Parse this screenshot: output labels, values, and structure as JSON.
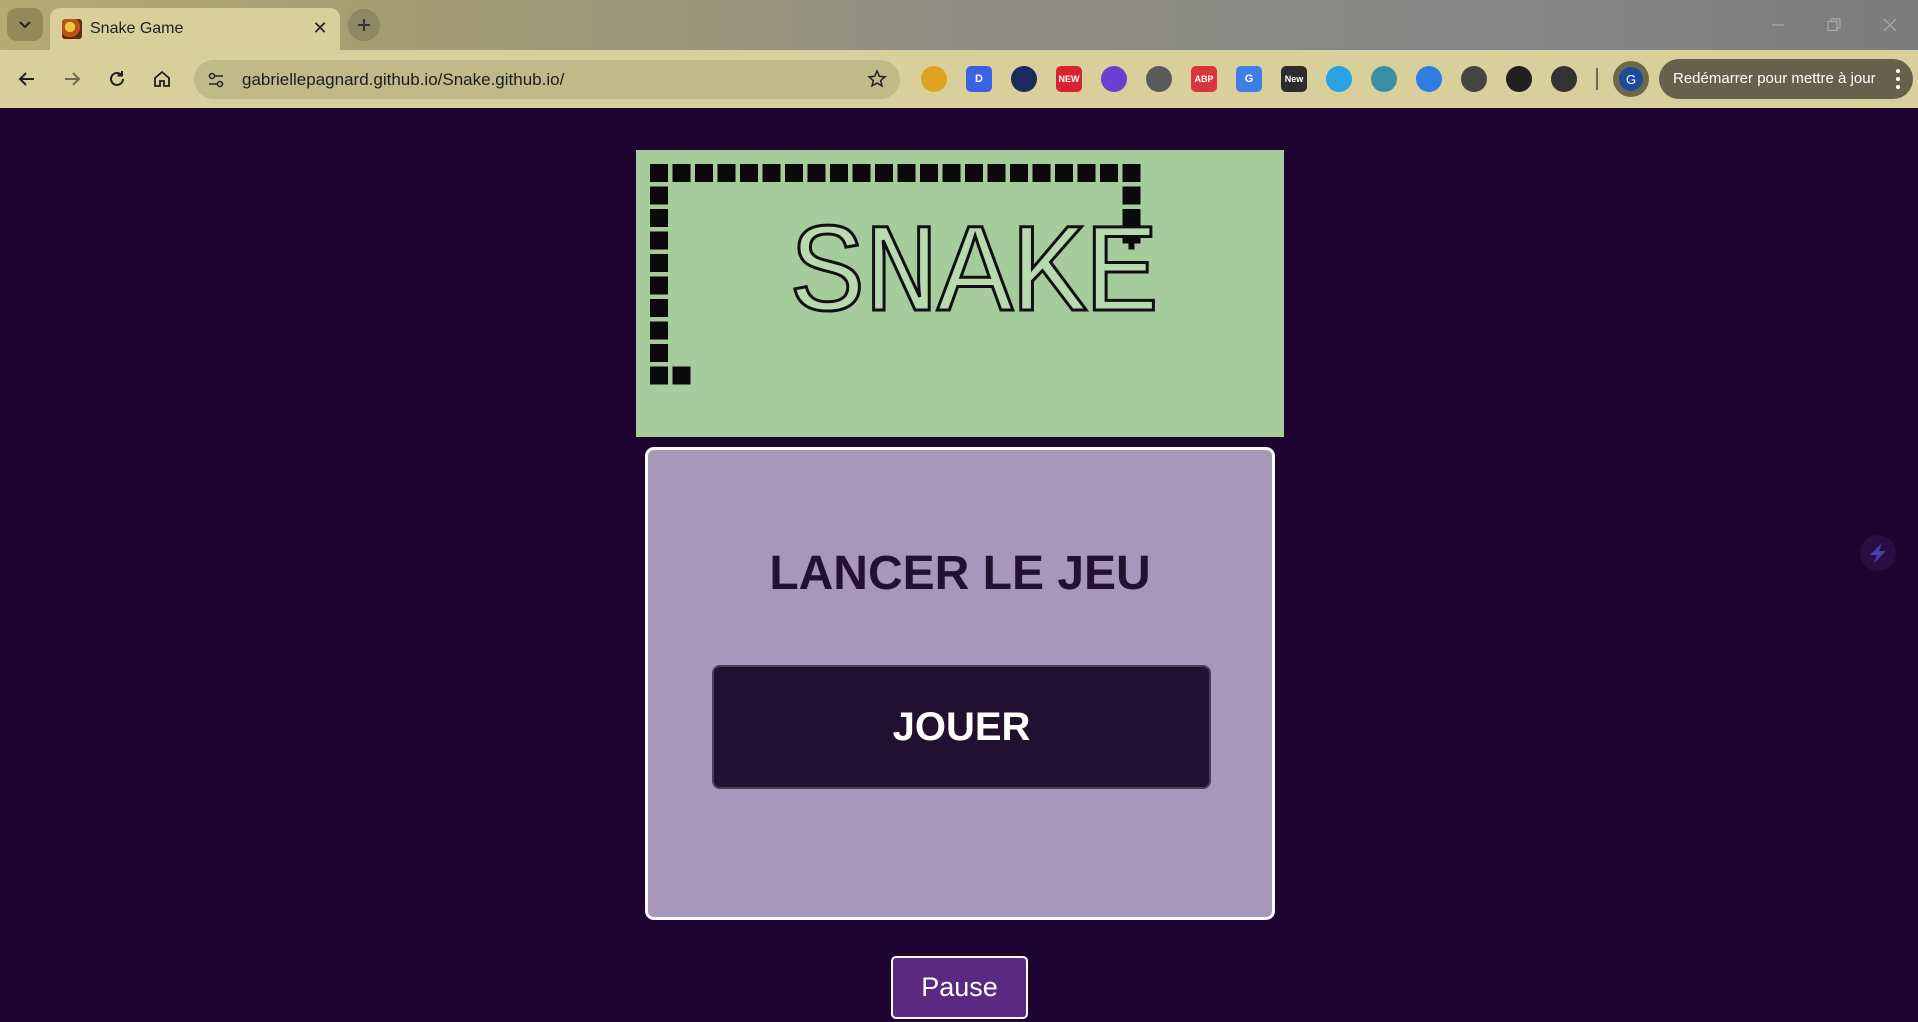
{
  "browser": {
    "tab": {
      "title": "Snake Game",
      "close_glyph": "✕"
    },
    "new_tab_glyph": "+",
    "address": {
      "url": "gabriellepagnard.github.io/Snake.github.io/"
    },
    "extensions": [
      {
        "name": "emoji-extension-icon",
        "label": "",
        "color": "#e0a31f"
      },
      {
        "name": "d-extension-icon",
        "label": "D",
        "color": "#3a62e3"
      },
      {
        "name": "flame-extension-icon",
        "label": "",
        "color": "#1b2a5c"
      },
      {
        "name": "new-badge-extension-icon",
        "label": "NEW",
        "color": "#d8232e"
      },
      {
        "name": "sparkle-extension-icon",
        "label": "",
        "color": "#6b3fd4"
      },
      {
        "name": "aperture-extension-icon",
        "label": "",
        "color": "#5a5a5a"
      },
      {
        "name": "adblock-extension-icon",
        "label": "ABP",
        "color": "#d7353a"
      },
      {
        "name": "translate-extension-icon",
        "label": "G",
        "color": "#3f7ee8"
      },
      {
        "name": "new-extension-icon",
        "label": "New",
        "color": "#2c2c2c"
      },
      {
        "name": "target-extension-icon",
        "label": "",
        "color": "#2aa1e0"
      },
      {
        "name": "react-extension-icon",
        "label": "",
        "color": "#3a8fa6"
      },
      {
        "name": "swirl-extension-icon",
        "label": "",
        "color": "#2e7ee0"
      },
      {
        "name": "eyedropper-extension-icon",
        "label": "",
        "color": "#444444"
      },
      {
        "name": "dark-square-extension-icon",
        "label": "",
        "color": "#202020"
      },
      {
        "name": "puzzle-extensions-icon",
        "label": "",
        "color": "#333333"
      }
    ],
    "profile_initial": "G",
    "update_button": "Redémarrer pour mettre à jour"
  },
  "page": {
    "banner_title": "SNAKE",
    "panel_title": "LANCER LE JEU",
    "play_button": "JOUER",
    "pause_button": "Pause"
  },
  "colors": {
    "page_background": "#1e0430",
    "banner_green": "#a6cb9c",
    "panel_lilac": "#a996bb",
    "play_button_bg": "#221031",
    "pause_button_bg": "#5b2982"
  }
}
